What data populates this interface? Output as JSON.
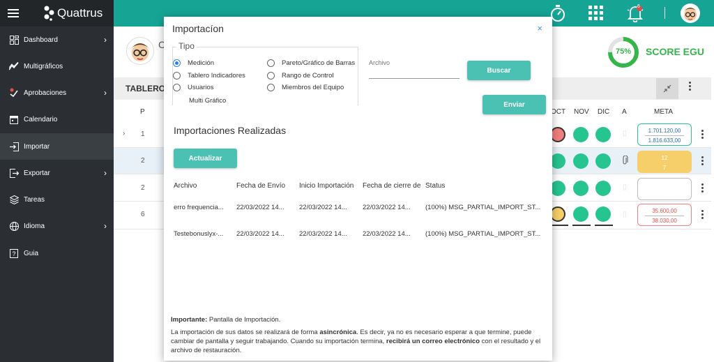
{
  "sidebar": {
    "brand": "Quattrus",
    "items": [
      {
        "label": "Dashboard",
        "chevron": true
      },
      {
        "label": "Multigráficos",
        "chevron": false
      },
      {
        "label": "Aprobaciones",
        "chevron": true
      },
      {
        "label": "Calendario",
        "chevron": false
      },
      {
        "label": "Importar",
        "chevron": false
      },
      {
        "label": "Exportar",
        "chevron": true
      },
      {
        "label": "Tareas",
        "chevron": false
      },
      {
        "label": "Idioma",
        "chevron": true
      },
      {
        "label": "Guia",
        "chevron": false
      }
    ]
  },
  "background": {
    "score_value": "75%",
    "score_label": "SCORE EGU",
    "header_partial": "C",
    "tablero_label": "TABLERO",
    "columns": {
      "p": "P",
      "oct": "OCT",
      "nov": "NOV",
      "dic": "DIC",
      "a": "A",
      "meta": "META"
    },
    "rows": [
      {
        "p": "1",
        "meta_top": "1.701.120,00",
        "meta_bottom": "1.816.633,00"
      },
      {
        "p": "2",
        "meta_top": "12",
        "meta_bottom": "7"
      },
      {
        "p": "2",
        "meta_top": "",
        "meta_bottom": ""
      },
      {
        "p": "6",
        "meta_top": "35.600,00",
        "meta_bottom": "38.030,00"
      }
    ]
  },
  "modal": {
    "title": "Importacíon",
    "close": "×",
    "tipo_legend": "Tipo",
    "radios": [
      "Medición",
      "Tablero Indicadores",
      "Usuarios",
      "Multi Gráfico",
      "Pareto/Gráfico de Barras",
      "Rango de Control",
      "Miembros del Equipo"
    ],
    "archivo_label": "Archivo",
    "buscar": "Buscar",
    "enviar": "Enviar",
    "imports_title": "Importaciones Realizadas",
    "actualizar": "Actualizar",
    "table_headers": [
      "Archivo",
      "Fecha de Envío",
      "Inicio Importación",
      "Fecha de cierre de",
      "Status"
    ],
    "table_rows": [
      [
        "erro frequencia...",
        "22/03/2022 14...",
        "22/03/2022 14...",
        "22/03/2022 14...",
        "(100%) MSG_PARTIAL_IMPORT_ST..."
      ],
      [
        "Testebonuslyx-...",
        "22/03/2022 14...",
        "22/03/2022 14...",
        "22/03/2022 14...",
        "(100%) MSG_PARTIAL_IMPORT_ST..."
      ]
    ],
    "note_bold": "Importante:",
    "note_rest": " Pantalla de Importación.",
    "para_1": "La importación de sus datos se realizará de forma ",
    "para_b1": "asincrónica",
    "para_2": ". Es decir, ya no es necesario esperar a que termine, puede cambiar de pantalla y seguir trabajando. Cuando su importación termina, ",
    "para_b2": "recibirá un correo electrónico",
    "para_3": " con el resultado y el archivo de restauración."
  },
  "topbar": {
    "notification_count": "6"
  }
}
